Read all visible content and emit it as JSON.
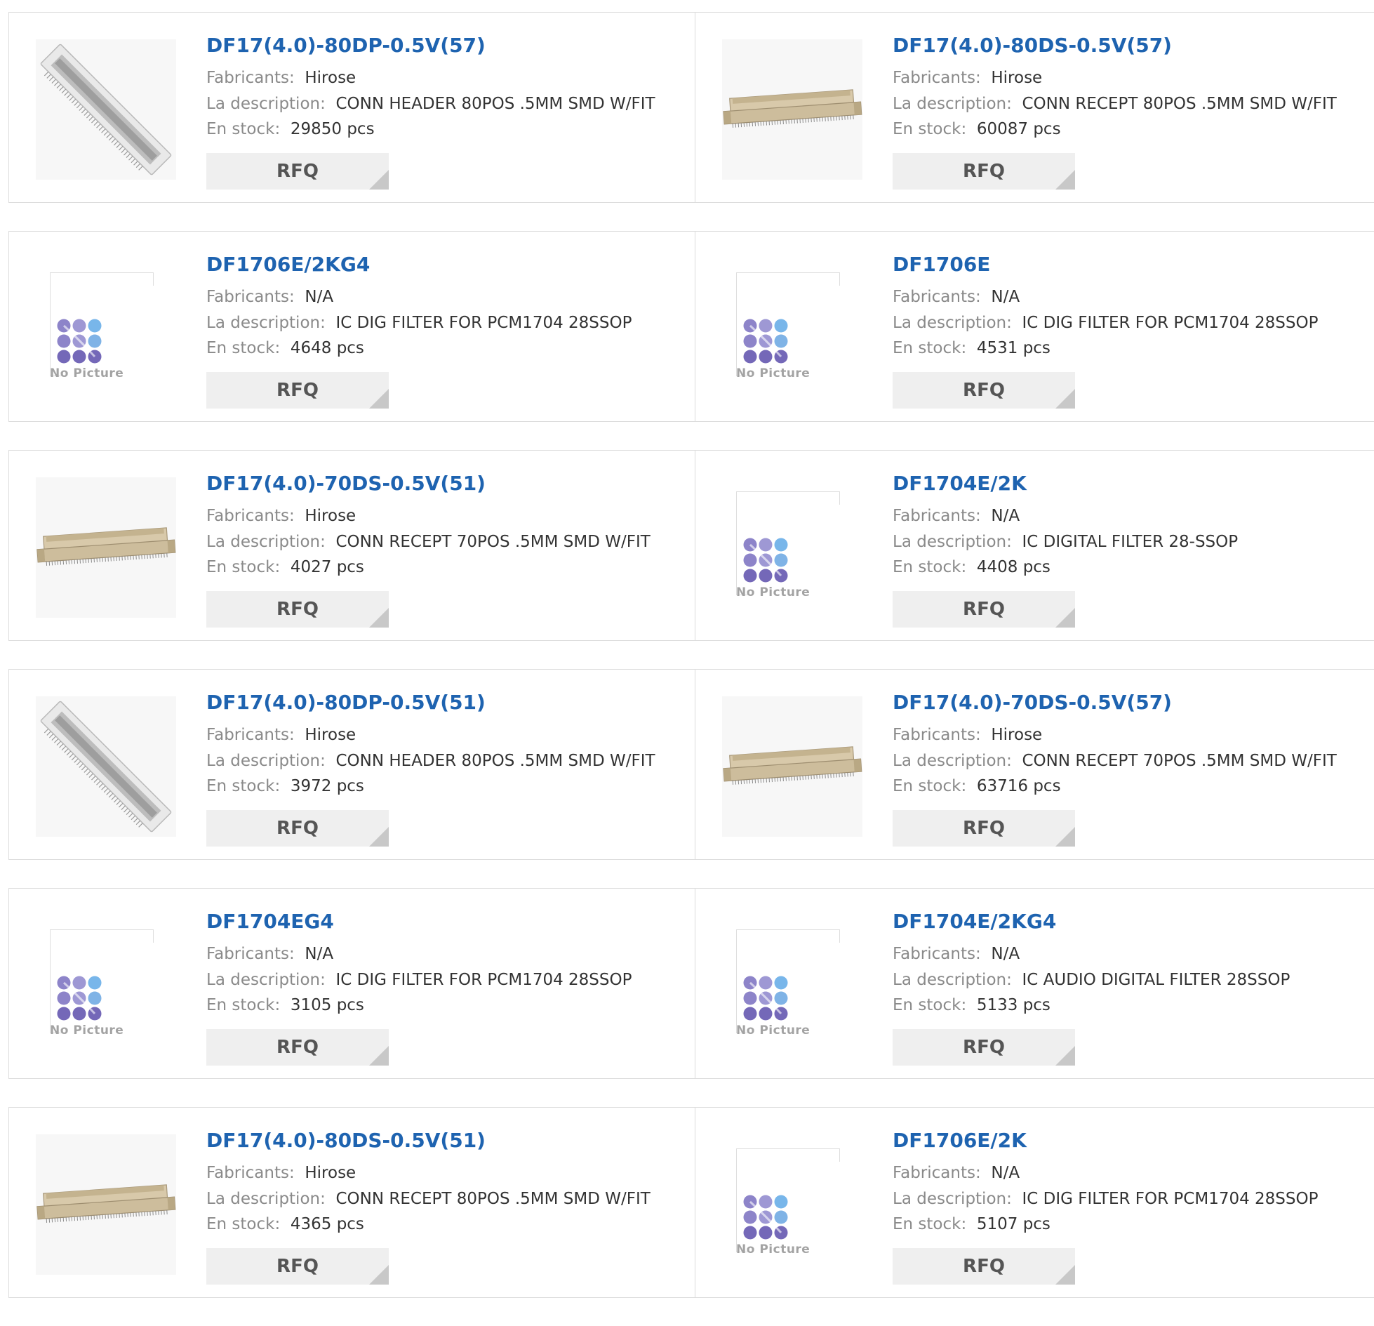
{
  "labels": {
    "manufacturer": "Fabricants:",
    "description": "La description:",
    "stock": "En stock:",
    "rfq": "RFQ",
    "no_picture": "No Picture"
  },
  "colors": {
    "title": "#1e63b0",
    "label": "#8a8a8a",
    "value": "#333333",
    "rfq_bg": "#efefef"
  },
  "products": [
    {
      "part": "DF17(4.0)-80DP-0.5V(57)",
      "manufacturer": "Hirose",
      "description": "CONN HEADER 80POS .5MM SMD W/FIT",
      "stock": "29850 pcs",
      "image": "connector-header-diagonal"
    },
    {
      "part": "DF17(4.0)-80DS-0.5V(57)",
      "manufacturer": "Hirose",
      "description": "CONN RECEPT 80POS .5MM SMD W/FIT",
      "stock": "60087 pcs",
      "image": "connector-receptacle"
    },
    {
      "part": "DF1706E/2KG4",
      "manufacturer": "N/A",
      "description": "IC DIG FILTER FOR PCM1704 28SSOP",
      "stock": "4648 pcs",
      "image": "no-picture"
    },
    {
      "part": "DF1706E",
      "manufacturer": "N/A",
      "description": "IC DIG FILTER FOR PCM1704 28SSOP",
      "stock": "4531 pcs",
      "image": "no-picture"
    },
    {
      "part": "DF17(4.0)-70DS-0.5V(51)",
      "manufacturer": "Hirose",
      "description": "CONN RECEPT 70POS .5MM SMD W/FIT",
      "stock": "4027 pcs",
      "image": "connector-receptacle"
    },
    {
      "part": "DF1704E/2K",
      "manufacturer": "N/A",
      "description": "IC DIGITAL FILTER 28-SSOP",
      "stock": "4408 pcs",
      "image": "no-picture"
    },
    {
      "part": "DF17(4.0)-80DP-0.5V(51)",
      "manufacturer": "Hirose",
      "description": "CONN HEADER 80POS .5MM SMD W/FIT",
      "stock": "3972 pcs",
      "image": "connector-header-diagonal"
    },
    {
      "part": "DF17(4.0)-70DS-0.5V(57)",
      "manufacturer": "Hirose",
      "description": "CONN RECEPT 70POS .5MM SMD W/FIT",
      "stock": "63716 pcs",
      "image": "connector-receptacle"
    },
    {
      "part": "DF1704EG4",
      "manufacturer": "N/A",
      "description": "IC DIG FILTER FOR PCM1704 28SSOP",
      "stock": "3105 pcs",
      "image": "no-picture"
    },
    {
      "part": "DF1704E/2KG4",
      "manufacturer": "N/A",
      "description": "IC AUDIO DIGITAL FILTER 28SSOP",
      "stock": "5133 pcs",
      "image": "no-picture"
    },
    {
      "part": "DF17(4.0)-80DS-0.5V(51)",
      "manufacturer": "Hirose",
      "description": "CONN RECEPT 80POS .5MM SMD W/FIT",
      "stock": "4365 pcs",
      "image": "connector-receptacle"
    },
    {
      "part": "DF1706E/2K",
      "manufacturer": "N/A",
      "description": "IC DIG FILTER FOR PCM1704 28SSOP",
      "stock": "5107 pcs",
      "image": "no-picture"
    }
  ]
}
